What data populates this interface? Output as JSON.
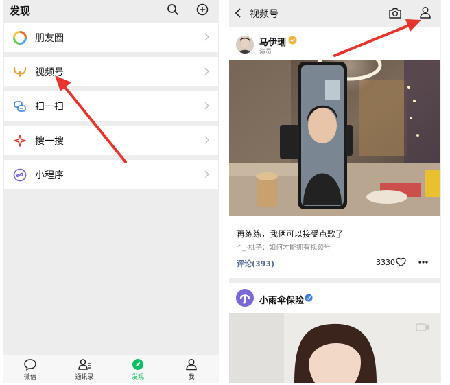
{
  "left_screen": {
    "title": "发现",
    "header_icons": [
      "search-icon",
      "plus-circle-icon"
    ],
    "menu": [
      {
        "label": "朋友圈",
        "icon": "moments-icon"
      },
      {
        "label": "视频号",
        "icon": "channels-icon"
      },
      {
        "label": "扫一扫",
        "icon": "scan-icon"
      },
      {
        "label": "搜一搜",
        "icon": "search-search-icon"
      },
      {
        "label": "小程序",
        "icon": "mini-program-icon"
      }
    ],
    "tabs": [
      {
        "label": "微信",
        "icon": "chat-icon"
      },
      {
        "label": "通讯录",
        "icon": "contacts-icon"
      },
      {
        "label": "发现",
        "icon": "discover-icon",
        "active": true
      },
      {
        "label": "我",
        "icon": "me-icon"
      }
    ]
  },
  "right_screen": {
    "title": "视频号",
    "header_icons": [
      "back-icon",
      "camera-icon",
      "user-icon"
    ],
    "posts": [
      {
        "author": "马伊琍",
        "role": "演员",
        "verified": "gold",
        "caption": "再练练，我俩可以接受点歌了",
        "subtext": "^_-桃子：如何才能拥有视频号",
        "comments_label": "评论(393)",
        "likes": "3330"
      },
      {
        "author": "小雨伞保险",
        "verified": "blue"
      }
    ]
  },
  "colors": {
    "accent_green": "#07c160",
    "link_blue": "#576b95",
    "arrow_red": "#e8342c",
    "background_gray": "#ededed"
  }
}
